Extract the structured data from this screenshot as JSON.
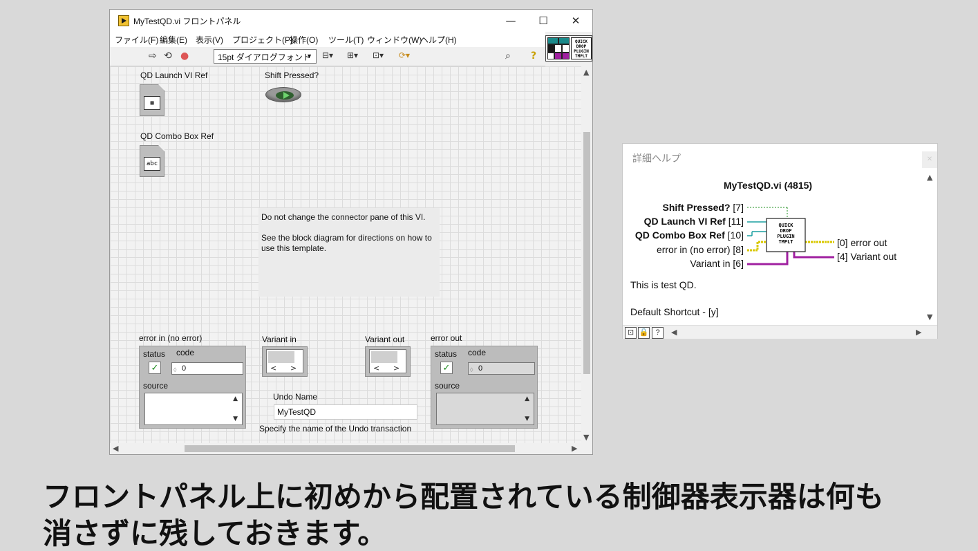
{
  "window": {
    "title": "MyTestQD.vi フロントパネル",
    "controls": {
      "minimize": "—",
      "maximize": "☐",
      "close": "✕"
    }
  },
  "menu": [
    "ファイル(F)",
    "編集(E)",
    "表示(V)",
    "プロジェクト(P)",
    "操作(O)",
    "ツール(T)",
    "ウィンドウ(W)",
    "ヘルプ(H)"
  ],
  "toolbar": {
    "font": "15pt ダイアログフォント",
    "icons": [
      "run-arrow-icon",
      "run-continuously-icon",
      "abort-icon",
      "align-icon",
      "distribute-icon",
      "resize-icon",
      "reorder-icon",
      "search-icon",
      "help-icon"
    ]
  },
  "connector_icon": {
    "text": "QUICK DROP PLUGIN TMPLT"
  },
  "front_panel": {
    "qd_launch_label": "QD Launch VI Ref",
    "shift_pressed_label": "Shift Pressed?",
    "qd_combo_label": "QD Combo Box Ref",
    "combo_inner": "abc",
    "note_line1": "Do not change the connector pane of this VI.",
    "note_line2": "See the block diagram for directions on how to use this template.",
    "error_in": {
      "label": "error in (no error)",
      "status": "status",
      "code_label": "code",
      "code": "0",
      "source": "source"
    },
    "variant_in": "Variant in",
    "variant_out": "Variant out",
    "error_out": {
      "label": "error out",
      "status": "status",
      "code_label": "code",
      "code": "0",
      "source": "source"
    },
    "undo_name_label": "Undo Name",
    "undo_name_value": "MyTestQD",
    "undo_hint": "Specify the name of the Undo transaction"
  },
  "help_window": {
    "title": "詳細ヘルプ",
    "vi_name": "MyTestQD.vi (4815)",
    "terminals_in": [
      {
        "name": "Shift Pressed?",
        "index": "[7]",
        "bold": true
      },
      {
        "name": "QD Launch VI Ref",
        "index": "[11]",
        "bold": true
      },
      {
        "name": "QD Combo Box Ref",
        "index": "[10]",
        "bold": true
      },
      {
        "name": "error in (no error)",
        "index": "[8]",
        "bold": false
      },
      {
        "name": "Variant in",
        "index": "[6]",
        "bold": false
      }
    ],
    "terminals_out": [
      {
        "index": "[0]",
        "name": "error out"
      },
      {
        "index": "[4]",
        "name": "Variant out"
      }
    ],
    "description": "This is test QD.",
    "shortcut": "Default Shortcut - [y]"
  },
  "caption": {
    "line1": "フロントパネル上に初めから配置されている制御器表示器は何も",
    "line2": "消さずに残しておきます。"
  },
  "colors": {
    "wire_error": "#d9c800",
    "wire_variant": "#a020a0",
    "wire_ref": "#1a9fa0",
    "wire_bool": "#1f8f1f"
  }
}
